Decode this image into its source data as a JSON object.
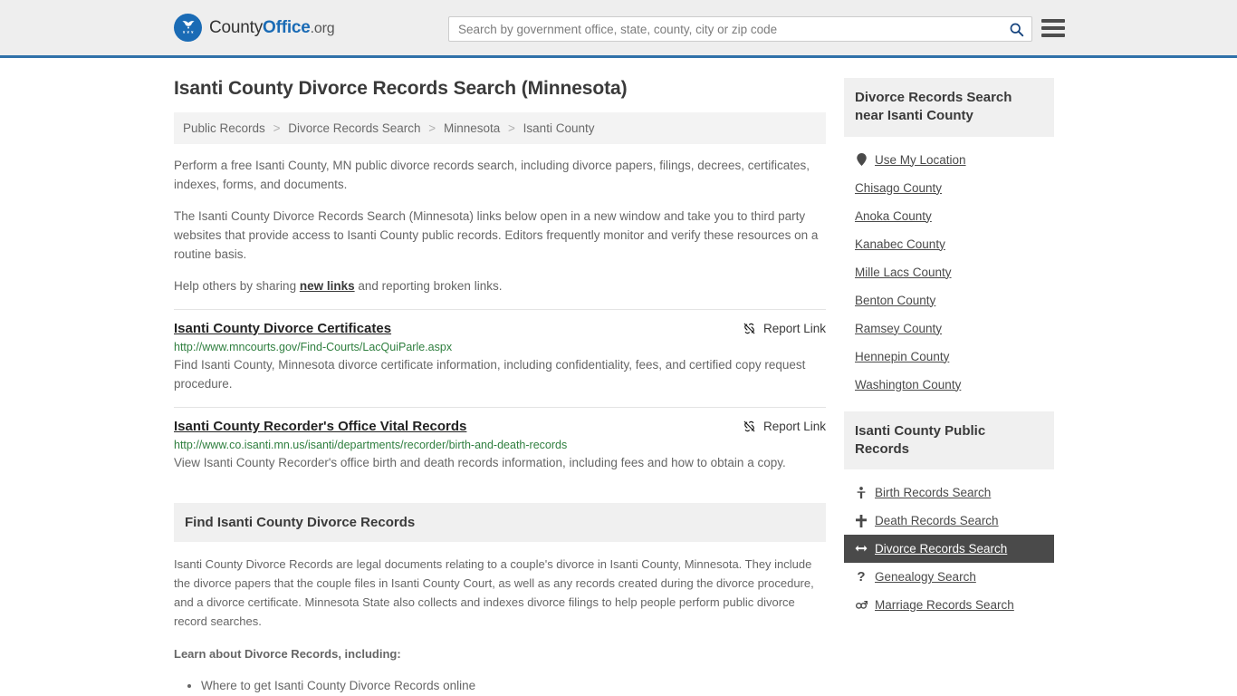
{
  "header": {
    "brand": {
      "part1": "County",
      "part2": "Office",
      "part3": ".org",
      "logo_icon": "eagle-seal-icon"
    },
    "search": {
      "placeholder": "Search by government office, state, county, city or zip code",
      "value": "",
      "search_icon": "search-icon"
    },
    "menu_icon": "hamburger-menu-icon"
  },
  "main": {
    "page_title": "Isanti County Divorce Records Search (Minnesota)",
    "breadcrumb": [
      {
        "label": "Public Records"
      },
      {
        "label": "Divorce Records Search"
      },
      {
        "label": "Minnesota"
      },
      {
        "label": "Isanti County"
      }
    ],
    "breadcrumb_separator": ">",
    "intro_paragraphs": [
      "Perform a free Isanti County, MN public divorce records search, including divorce papers, filings, decrees, certificates, indexes, forms, and documents.",
      "The Isanti County Divorce Records Search (Minnesota) links below open in a new window and take you to third party websites that provide access to Isanti County public records. Editors frequently monitor and verify these resources on a routine basis."
    ],
    "help_prefix": "Help others by sharing ",
    "help_link": "new links",
    "help_suffix": " and reporting broken links.",
    "report_link_label": "Report Link",
    "report_link_icon": "broken-link-icon",
    "results": [
      {
        "title": "Isanti County Divorce Certificates",
        "url": "http://www.mncourts.gov/Find-Courts/LacQuiParle.aspx",
        "description": "Find Isanti County, Minnesota divorce certificate information, including confidentiality, fees, and certified copy request procedure."
      },
      {
        "title": "Isanti County Recorder's Office Vital Records",
        "url": "http://www.co.isanti.mn.us/isanti/departments/recorder/birth-and-death-records",
        "description": "View Isanti County Recorder's office birth and death records information, including fees and how to obtain a copy."
      }
    ],
    "find_section": {
      "heading": "Find Isanti County Divorce Records",
      "body": "Isanti County Divorce Records are legal documents relating to a couple's divorce in Isanti County, Minnesota. They include the divorce papers that the couple files in Isanti County Court, as well as any records created during the divorce procedure, and a divorce certificate. Minnesota State also collects and indexes divorce filings to help people perform public divorce record searches.",
      "learn_heading": "Learn about Divorce Records, including:",
      "bullets": [
        "Where to get Isanti County Divorce Records online"
      ]
    }
  },
  "sidebar": {
    "near_card": {
      "heading": "Divorce Records Search near Isanti County",
      "items": [
        {
          "label": "Use My Location",
          "icon": "map-pin-icon",
          "active": false
        },
        {
          "label": "Chisago County",
          "icon": "",
          "active": false
        },
        {
          "label": "Anoka County",
          "icon": "",
          "active": false
        },
        {
          "label": "Kanabec County",
          "icon": "",
          "active": false
        },
        {
          "label": "Mille Lacs County",
          "icon": "",
          "active": false
        },
        {
          "label": "Benton County",
          "icon": "",
          "active": false
        },
        {
          "label": "Ramsey County",
          "icon": "",
          "active": false
        },
        {
          "label": "Hennepin County",
          "icon": "",
          "active": false
        },
        {
          "label": "Washington County",
          "icon": "",
          "active": false
        }
      ]
    },
    "public_records_card": {
      "heading": "Isanti County Public Records",
      "items": [
        {
          "label": "Birth Records Search",
          "icon": "baby-icon",
          "glyph": "\u0001",
          "active": false
        },
        {
          "label": "Death Records Search",
          "icon": "cross-icon",
          "glyph": "✚",
          "active": false
        },
        {
          "label": "Divorce Records Search",
          "icon": "arrows-left-right-icon",
          "glyph": "↔",
          "active": true
        },
        {
          "label": "Genealogy Search",
          "icon": "question-mark-icon",
          "glyph": "?",
          "active": false
        },
        {
          "label": "Marriage Records Search",
          "icon": "gender-symbols-icon",
          "glyph": "⚥",
          "active": false
        }
      ]
    }
  }
}
